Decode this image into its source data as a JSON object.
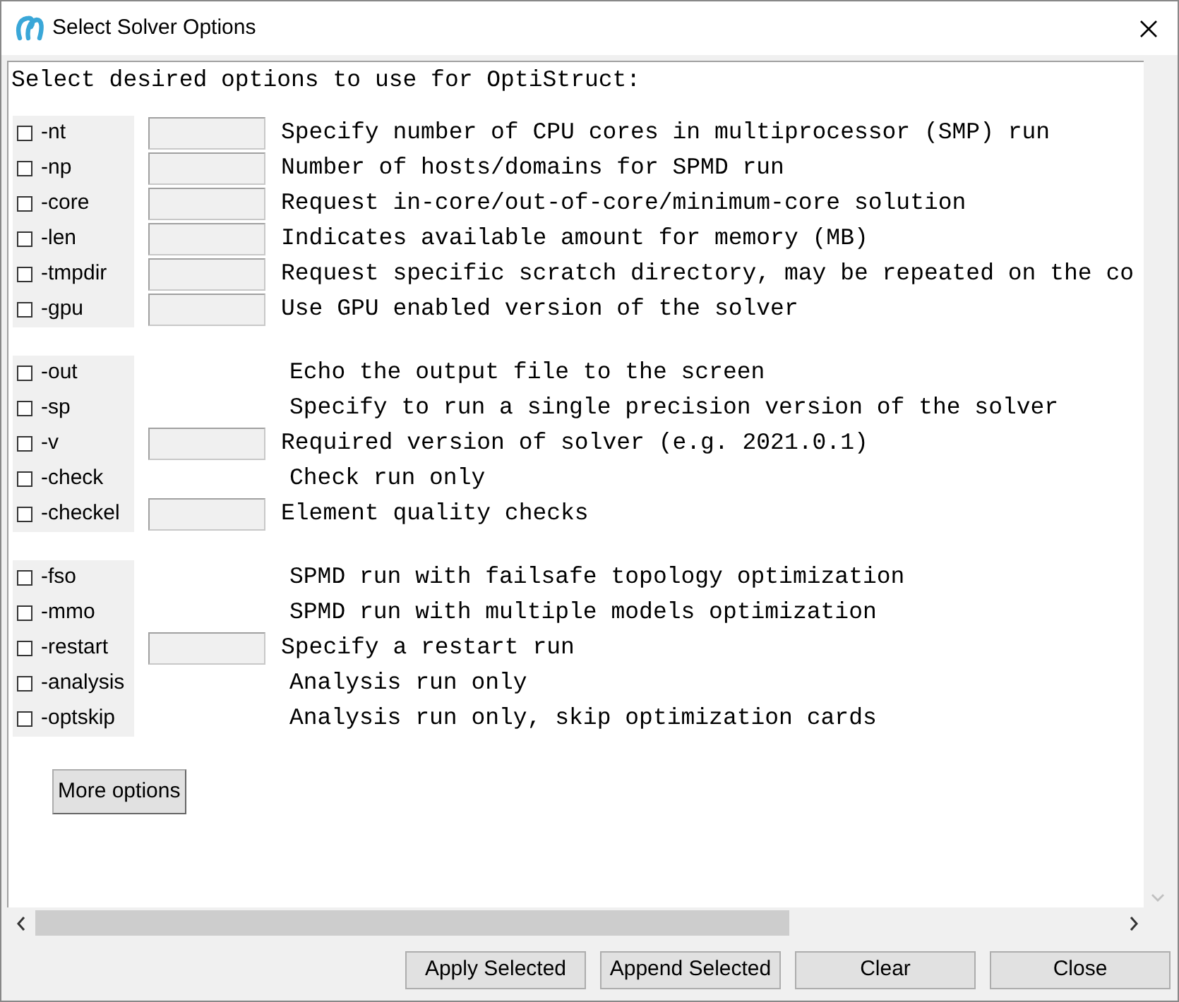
{
  "window": {
    "title": "Select Solver Options"
  },
  "heading": "Select desired options to use for OptiStruct:",
  "groups": [
    {
      "options": [
        {
          "flag": "-nt",
          "checked": false,
          "has_field": true,
          "description": "Specify number of CPU cores in multiprocessor (SMP) run"
        },
        {
          "flag": "-np",
          "checked": false,
          "has_field": true,
          "description": "Number of hosts/domains for SPMD run"
        },
        {
          "flag": "-core",
          "checked": false,
          "has_field": true,
          "description": "Request in-core/out-of-core/minimum-core solution"
        },
        {
          "flag": "-len",
          "checked": false,
          "has_field": true,
          "description": "Indicates available amount for memory (MB)"
        },
        {
          "flag": "-tmpdir",
          "checked": false,
          "has_field": true,
          "description": "Request specific scratch directory, may be repeated on the co"
        },
        {
          "flag": "-gpu",
          "checked": false,
          "has_field": true,
          "description": "Use GPU enabled version of the solver"
        }
      ]
    },
    {
      "options": [
        {
          "flag": "-out",
          "checked": false,
          "has_field": false,
          "description": "Echo the output file to the screen"
        },
        {
          "flag": "-sp",
          "checked": false,
          "has_field": false,
          "description": "Specify to run a single precision version of the solver"
        },
        {
          "flag": "-v",
          "checked": false,
          "has_field": true,
          "description": "Required version of solver (e.g. 2021.0.1)"
        },
        {
          "flag": "-check",
          "checked": false,
          "has_field": false,
          "description": "Check run only"
        },
        {
          "flag": "-checkel",
          "checked": false,
          "has_field": true,
          "description": "Element quality checks"
        }
      ]
    },
    {
      "options": [
        {
          "flag": "-fso",
          "checked": false,
          "has_field": false,
          "description": "SPMD run with failsafe topology optimization"
        },
        {
          "flag": "-mmo",
          "checked": false,
          "has_field": false,
          "description": "SPMD run with multiple models optimization"
        },
        {
          "flag": "-restart",
          "checked": false,
          "has_field": true,
          "description": "Specify a restart run"
        },
        {
          "flag": "-analysis",
          "checked": false,
          "has_field": false,
          "description": "Analysis run only"
        },
        {
          "flag": "-optskip",
          "checked": false,
          "has_field": false,
          "description": "Analysis run only, skip optimization cards"
        }
      ]
    }
  ],
  "more_button": "More options",
  "buttons": [
    "Apply Selected",
    "Append Selected",
    "Clear",
    "Close"
  ]
}
